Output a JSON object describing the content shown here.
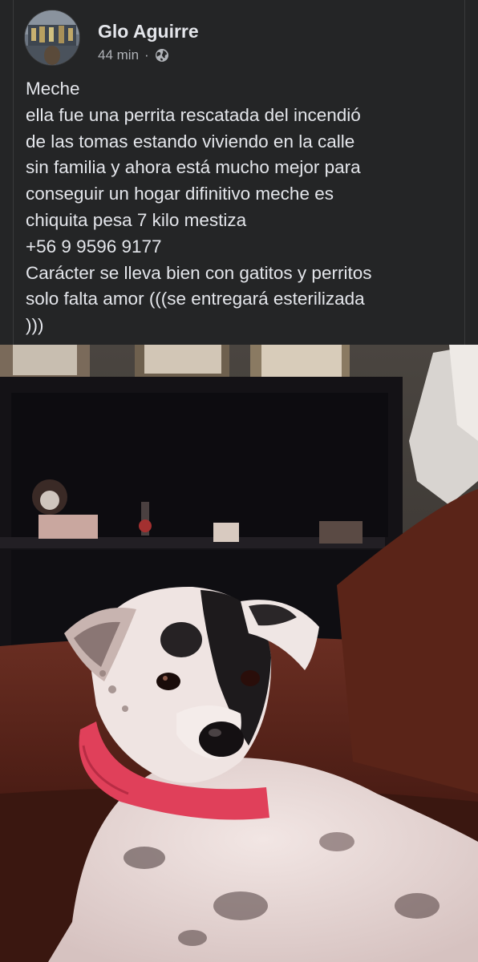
{
  "post": {
    "author": "Glo Aguirre",
    "time": "44 min",
    "separator": "·",
    "privacy_icon": "globe-icon",
    "lines": [
      "Meche",
      "ella fue una perrita rescatada del incendió",
      "de las tomas estando viviendo en la calle",
      "sin familia y ahora está mucho mejor  para",
      "conseguir un hogar difinitivo  meche es",
      "chiquita pesa 7 kilo mestiza",
      "+56 9 9596 9177",
      "Carácter se lleva bien con gatitos y perritos",
      "solo falta amor (((se entregará esterilizada",
      ")))"
    ]
  },
  "photo": {
    "subject": "dog-photo"
  },
  "colors": {
    "background": "#242526",
    "primary_text": "#e4e6eb",
    "secondary_text": "#b0b3b8"
  }
}
